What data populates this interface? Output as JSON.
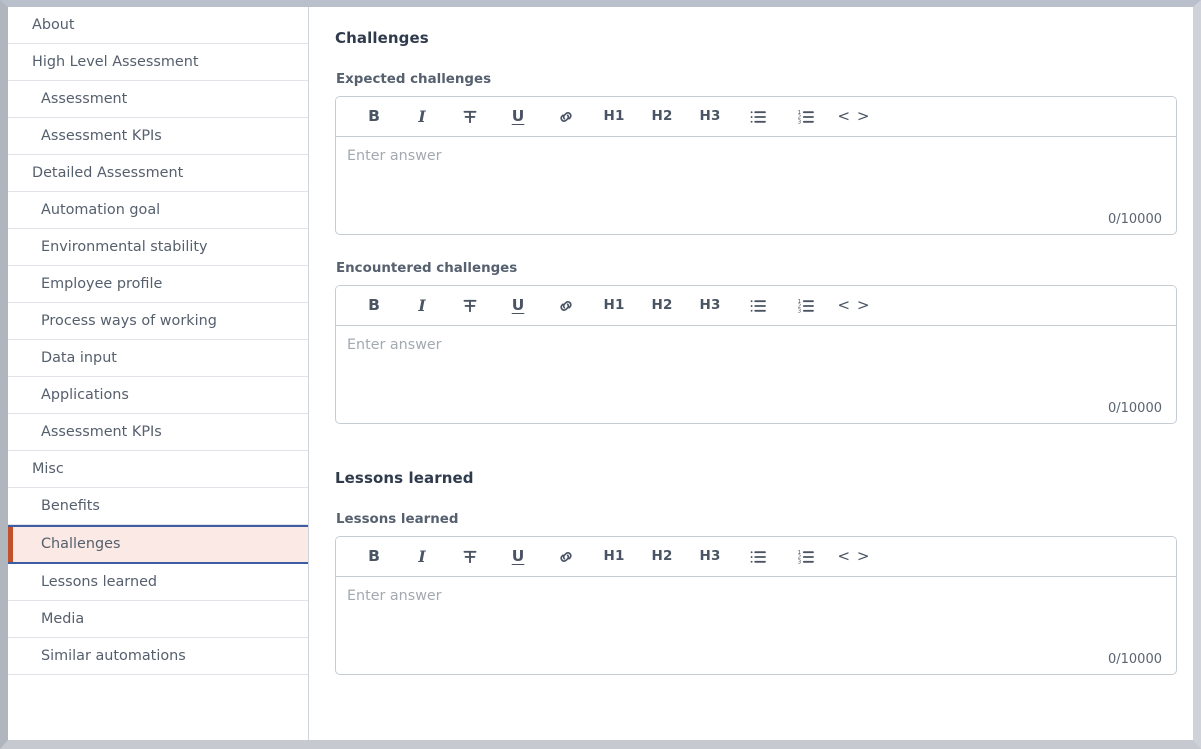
{
  "sidebar": {
    "items": [
      {
        "label": "About",
        "level": 0,
        "selected": false
      },
      {
        "label": "High Level Assessment",
        "level": 0,
        "selected": false
      },
      {
        "label": "Assessment",
        "level": 1,
        "selected": false
      },
      {
        "label": "Assessment KPIs",
        "level": 1,
        "selected": false
      },
      {
        "label": "Detailed Assessment",
        "level": 0,
        "selected": false
      },
      {
        "label": "Automation goal",
        "level": 1,
        "selected": false
      },
      {
        "label": "Environmental stability",
        "level": 1,
        "selected": false
      },
      {
        "label": "Employee profile",
        "level": 1,
        "selected": false
      },
      {
        "label": "Process ways of working",
        "level": 1,
        "selected": false
      },
      {
        "label": "Data input",
        "level": 1,
        "selected": false
      },
      {
        "label": "Applications",
        "level": 1,
        "selected": false
      },
      {
        "label": "Assessment KPIs",
        "level": 1,
        "selected": false
      },
      {
        "label": "Misc",
        "level": 0,
        "selected": false
      },
      {
        "label": "Benefits",
        "level": 1,
        "selected": false
      },
      {
        "label": "Challenges",
        "level": 1,
        "selected": true
      },
      {
        "label": "Lessons learned",
        "level": 1,
        "selected": false
      },
      {
        "label": "Media",
        "level": 1,
        "selected": false
      },
      {
        "label": "Similar automations",
        "level": 1,
        "selected": false
      }
    ]
  },
  "toolbar_buttons": [
    {
      "name": "bold-icon",
      "kind": "text",
      "glyph": "B",
      "class": "glyph"
    },
    {
      "name": "italic-icon",
      "kind": "text",
      "glyph": "I",
      "class": "glyph ital"
    },
    {
      "name": "strikethrough-icon",
      "kind": "strike",
      "glyph": "",
      "class": "glyph"
    },
    {
      "name": "underline-icon",
      "kind": "text",
      "glyph": "U",
      "class": "glyph und"
    },
    {
      "name": "link-icon",
      "kind": "link",
      "glyph": "",
      "class": "glyph"
    },
    {
      "name": "heading-1-icon",
      "kind": "text",
      "glyph": "H1",
      "class": "glyph head"
    },
    {
      "name": "heading-2-icon",
      "kind": "text",
      "glyph": "H2",
      "class": "glyph head"
    },
    {
      "name": "heading-3-icon",
      "kind": "text",
      "glyph": "H3",
      "class": "glyph head"
    },
    {
      "name": "bullet-list-icon",
      "kind": "bullets",
      "glyph": "",
      "class": "glyph"
    },
    {
      "name": "numbered-list-icon",
      "kind": "numbers",
      "glyph": "",
      "class": "glyph"
    },
    {
      "name": "code-icon",
      "kind": "text",
      "glyph": "< >",
      "class": "glyph code"
    }
  ],
  "main": {
    "sections": [
      {
        "title": "Challenges",
        "fields": [
          {
            "label": "Expected challenges",
            "placeholder": "Enter answer",
            "value": "",
            "counter": "0/10000"
          },
          {
            "label": "Encountered challenges",
            "placeholder": "Enter answer",
            "value": "",
            "counter": "0/10000"
          }
        ]
      },
      {
        "title": "Lessons learned",
        "fields": [
          {
            "label": "Lessons learned",
            "placeholder": "Enter answer",
            "value": "",
            "counter": "0/10000"
          }
        ]
      }
    ]
  },
  "colors": {
    "selected_bg": "#fae9e5",
    "selected_border": "#3c5ca4",
    "selected_accent": "#c1512b",
    "text": "#555f6d",
    "heading": "#2f3b4c",
    "border": "#c6ccd4"
  }
}
